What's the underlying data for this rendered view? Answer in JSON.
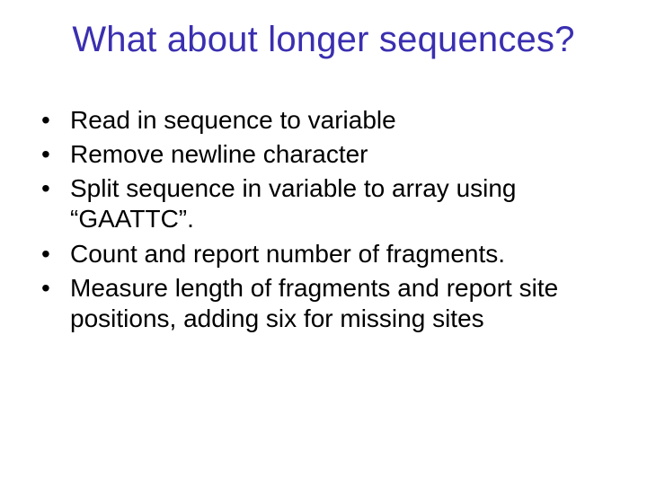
{
  "title": "What about longer sequences?",
  "bullets": [
    "Read in sequence to variable",
    "Remove newline character",
    "Split sequence in variable to array using “GAATTC”.",
    "Count and report number of fragments.",
    "Measure length of fragments and report site positions, adding six for missing sites"
  ]
}
